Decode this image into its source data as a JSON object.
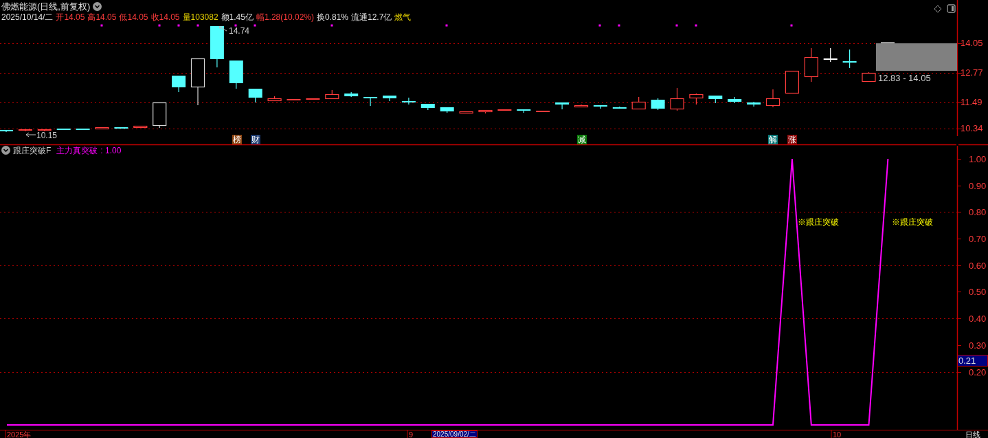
{
  "header": {
    "title": "佛燃能源(日线,前复权)",
    "quote": [
      {
        "text": "2025/10/14/二",
        "color": "#e0e0e0"
      },
      {
        "text": "开14.05",
        "color": "#ff3c3c"
      },
      {
        "text": "高14.05",
        "color": "#ff3c3c"
      },
      {
        "text": "低14.05",
        "color": "#ff3c3c"
      },
      {
        "text": "收14.05",
        "color": "#ff3c3c"
      },
      {
        "text": "量103082",
        "color": "#e6d200"
      },
      {
        "text": "额1.45亿",
        "color": "#e0e0e0"
      },
      {
        "text": "幅1.28(10.02%)",
        "color": "#ff3c3c"
      },
      {
        "text": "换0.81%",
        "color": "#e0e0e0"
      },
      {
        "text": "流通12.7亿",
        "color": "#e0e0e0"
      },
      {
        "text": "燃气",
        "color": "#e6d200"
      }
    ]
  },
  "price_chart": {
    "axis_labels": [
      "14.05",
      "12.77",
      "11.49",
      "10.34"
    ],
    "high_label": "14.74",
    "low_label": "10.15",
    "range_label": "12.83 - 14.05",
    "events": [
      {
        "text": "榜",
        "color": "#8b4513"
      },
      {
        "text": "财",
        "color": "#1c3a6e"
      },
      {
        "text": "减",
        "color": "#0a7a0a"
      },
      {
        "text": "解",
        "color": "#0a7a7a"
      },
      {
        "text": "涨",
        "color": "#8b0a0a"
      }
    ]
  },
  "indicator": {
    "name": "跟庄突破F",
    "legend_value": ": 1.00",
    "signals": [
      "※跟庄突破",
      "※跟庄突破"
    ],
    "cursor_value": "0.21",
    "chart_data": {
      "type": "line",
      "grid": true,
      "ylim": [
        -0.018,
        1.049
      ],
      "yticks": [
        {
          "value": 1,
          "label": "1.00"
        },
        {
          "value": 0.9,
          "label": "0.90"
        },
        {
          "value": 0.8,
          "label": "0.80"
        },
        {
          "value": 0.7,
          "label": "0.70"
        },
        {
          "value": 0.6,
          "label": "0.60"
        },
        {
          "value": 0.5,
          "label": "0.50"
        },
        {
          "value": 0.4,
          "label": "0.40"
        },
        {
          "value": 0.3,
          "label": "0.30"
        },
        {
          "value": 0.2,
          "label": "0.20"
        }
      ],
      "series": [
        {
          "name": "主力真突破",
          "color": "#ff00ff",
          "values": [
            0,
            0,
            0,
            0,
            0,
            0,
            0,
            0,
            0,
            0,
            0,
            0,
            0,
            0,
            0,
            0,
            0,
            0,
            0,
            0,
            0,
            0,
            0,
            0,
            0,
            0,
            0,
            0,
            0,
            0,
            0,
            0,
            0,
            0,
            0,
            0,
            0,
            0,
            0,
            0,
            0,
            1,
            0,
            0,
            0,
            0,
            1
          ]
        }
      ]
    }
  },
  "time_axis": {
    "labels": [
      "2025年",
      "9",
      "10"
    ],
    "cursor_date": "2025/09/02/二",
    "period": "日线"
  }
}
